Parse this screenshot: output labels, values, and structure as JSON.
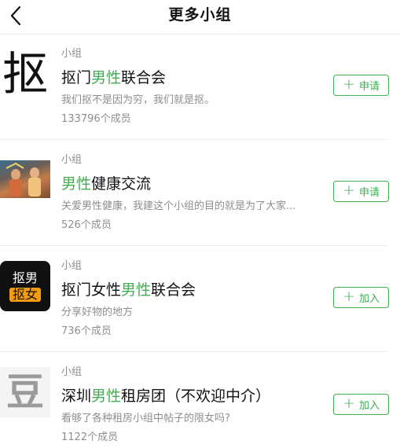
{
  "header": {
    "title": "更多小组",
    "back_icon": "chevron-left-icon"
  },
  "colors": {
    "accent": "#3fae50",
    "muted": "#8e8e8e",
    "badge_orange": "#f39c12"
  },
  "groups": [
    {
      "avatar": "抠",
      "type": "小组",
      "name_parts": [
        "抠门",
        "男性",
        "联合会"
      ],
      "desc": "我们抠不是因为穷，我们就是抠。",
      "members": "133796个成员",
      "action": "申请"
    },
    {
      "avatar": "photo",
      "type": "小组",
      "name_parts": [
        "",
        "男性",
        "健康交流"
      ],
      "desc": "关爱男性健康，我建这个小组的目的就是为了大家...",
      "members": "526个成员",
      "action": "申请"
    },
    {
      "avatar": [
        "抠男",
        "抠女"
      ],
      "type": "小组",
      "name_parts": [
        "抠门女性",
        "男性",
        "联合会"
      ],
      "desc": "分享好物的地方",
      "members": "736个成员",
      "action": "加入"
    },
    {
      "avatar": "豆",
      "type": "小组",
      "name_parts": [
        "深圳",
        "男性",
        "租房团（不欢迎中介）"
      ],
      "desc": "看够了各种租房小组中帖子的限女吗?",
      "members": "1122个成员",
      "action": "加入"
    }
  ]
}
